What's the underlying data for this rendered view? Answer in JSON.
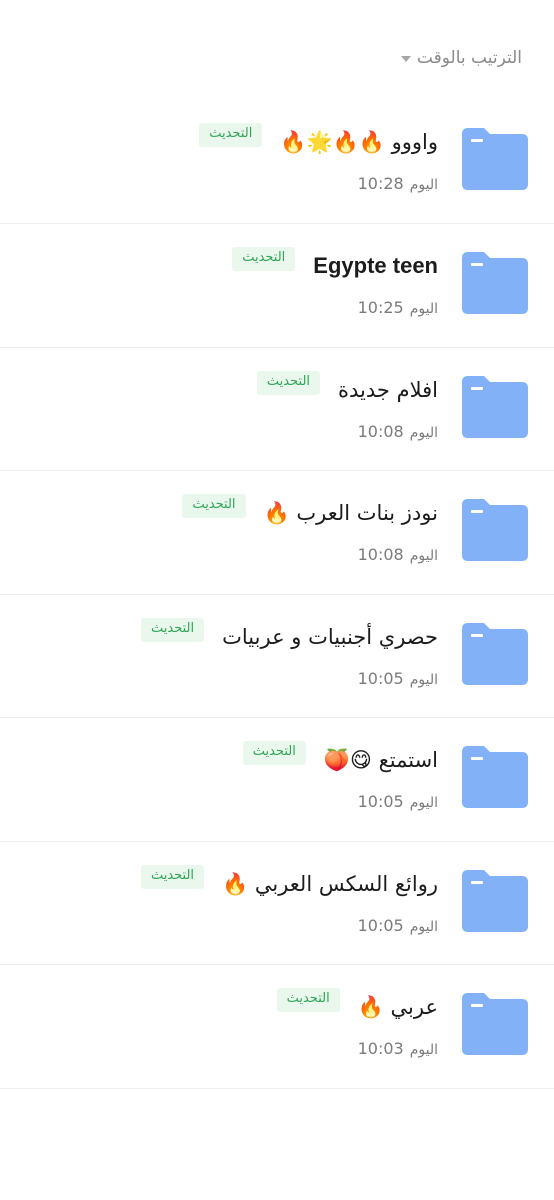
{
  "sort": {
    "label": "الترتيب بالوقت"
  },
  "badge_label": "التحديث",
  "folders": [
    {
      "title": "واووو 🔥🔥🌟🔥",
      "day": "اليوم",
      "time": "10:28"
    },
    {
      "title": "Egypte teen",
      "day": "اليوم",
      "time": "10:25"
    },
    {
      "title": "افلام جديدة",
      "day": "اليوم",
      "time": "10:08"
    },
    {
      "title": "نودز بنات العرب 🔥",
      "day": "اليوم",
      "time": "10:08"
    },
    {
      "title": "حصري أجنبيات و عربيات",
      "day": "اليوم",
      "time": "10:05"
    },
    {
      "title": "استمتع 😋🍑",
      "day": "اليوم",
      "time": "10:05"
    },
    {
      "title": "روائع السكس العربي 🔥",
      "day": "اليوم",
      "time": "10:05"
    },
    {
      "title": "عربي 🔥",
      "day": "اليوم",
      "time": "10:03"
    }
  ],
  "colors": {
    "folder": "#82b1f7",
    "folder_tab": "#ffffff",
    "badge_bg": "#eaf7ec",
    "badge_text": "#2ea657"
  }
}
